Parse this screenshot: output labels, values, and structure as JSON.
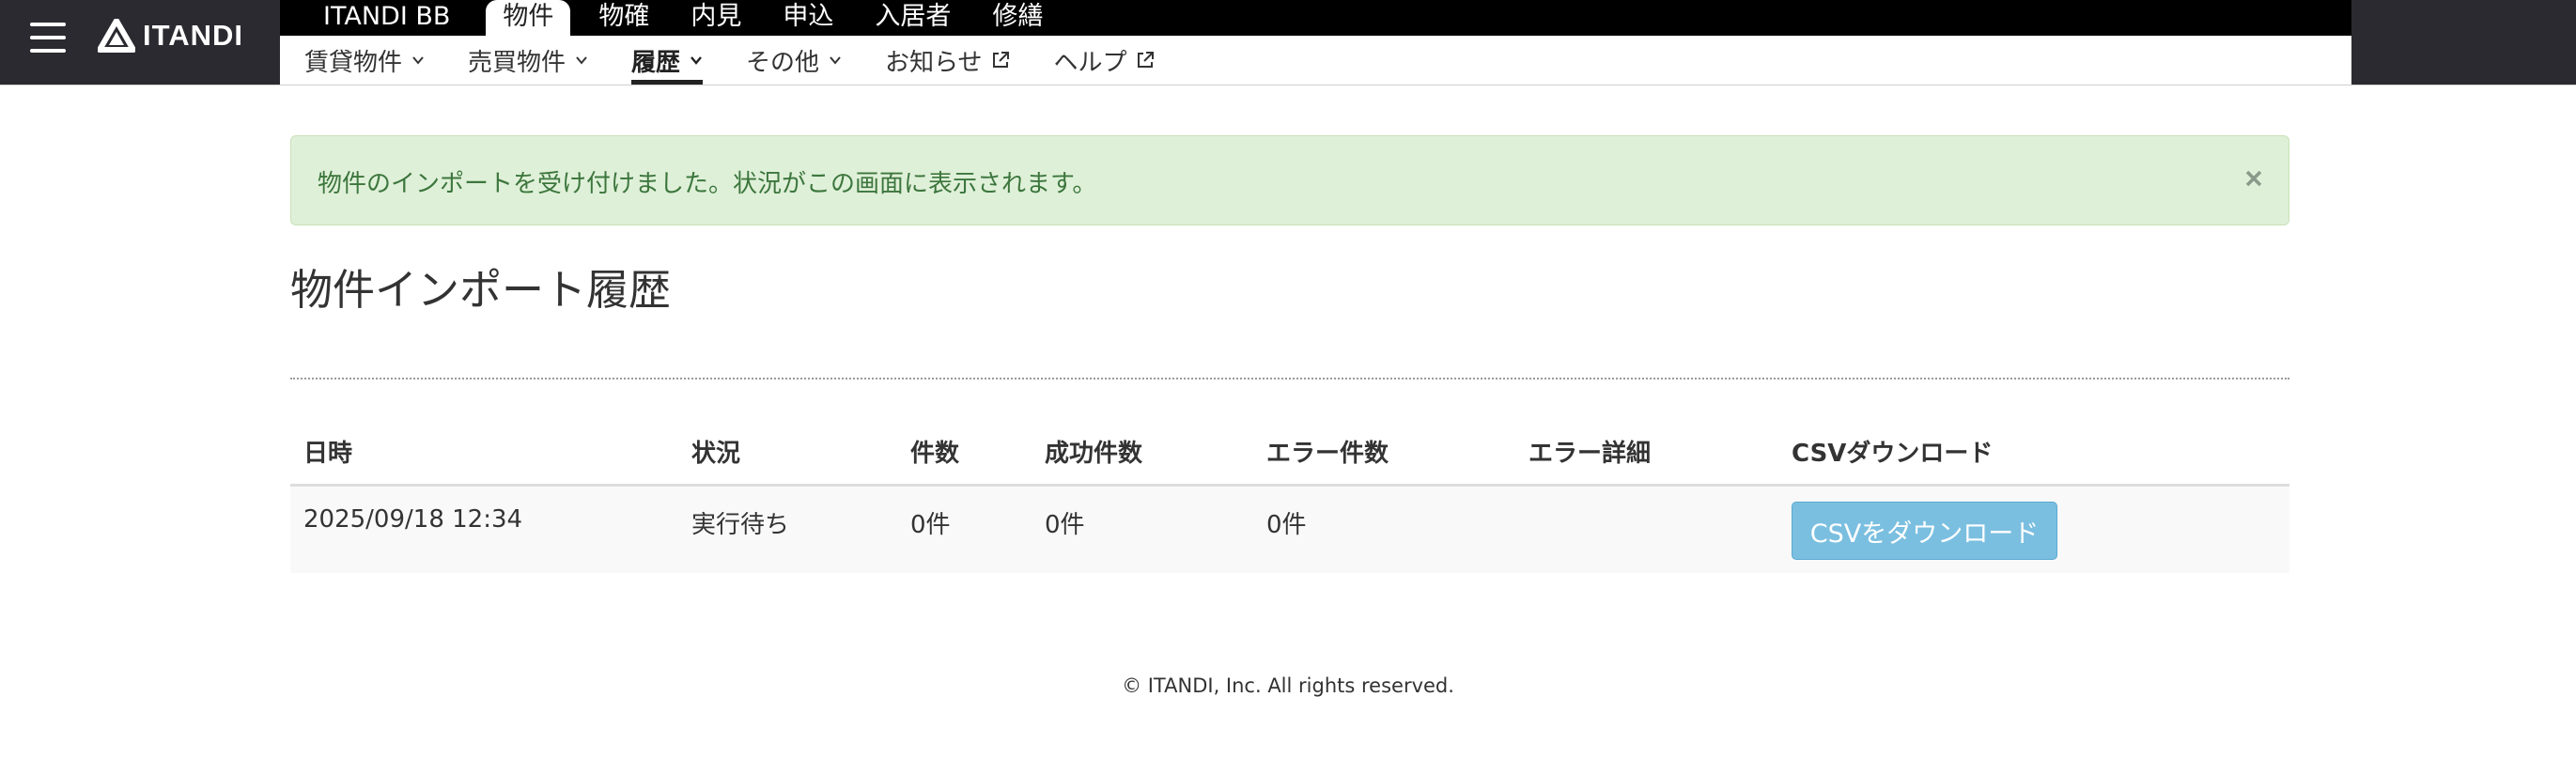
{
  "brand": {
    "name": "ITANDI"
  },
  "topnav": {
    "items": [
      {
        "label": "ITANDI BB",
        "active": false
      },
      {
        "label": "物件",
        "active": true
      },
      {
        "label": "物確",
        "active": false
      },
      {
        "label": "内見",
        "active": false
      },
      {
        "label": "申込",
        "active": false
      },
      {
        "label": "入居者",
        "active": false
      },
      {
        "label": "修繕",
        "active": false
      }
    ]
  },
  "subnav": {
    "items": [
      {
        "label": "賃貸物件",
        "icon": "chevron-down-icon"
      },
      {
        "label": "売買物件",
        "icon": "chevron-down-icon"
      },
      {
        "label": "履歴",
        "icon": "chevron-down-icon",
        "active": true
      },
      {
        "label": "その他",
        "icon": "chevron-down-icon"
      },
      {
        "label": "お知らせ",
        "icon": "external-link-icon"
      },
      {
        "label": "ヘルプ",
        "icon": "external-link-icon"
      }
    ]
  },
  "alert": {
    "message": "物件のインポートを受け付けました。状況がこの画面に表示されます。",
    "close_symbol": "×"
  },
  "page": {
    "title": "物件インポート履歴"
  },
  "table": {
    "headers": [
      "日時",
      "状況",
      "件数",
      "成功件数",
      "エラー件数",
      "エラー詳細",
      "CSVダウンロード"
    ],
    "rows": [
      {
        "datetime": "2025/09/18 12:34",
        "status": "実行待ち",
        "count": "0件",
        "success": "0件",
        "errors": "0件",
        "error_detail": "",
        "download_label": "CSVをダウンロード"
      }
    ]
  },
  "footer": {
    "copyright": "© ITANDI, Inc. All rights reserved."
  },
  "colors": {
    "header_bg": "#000000",
    "brand_bg": "#2a2a30",
    "alert_bg": "#dff0d8",
    "alert_text": "#3c763d",
    "button_bg": "#7bbfe0"
  }
}
